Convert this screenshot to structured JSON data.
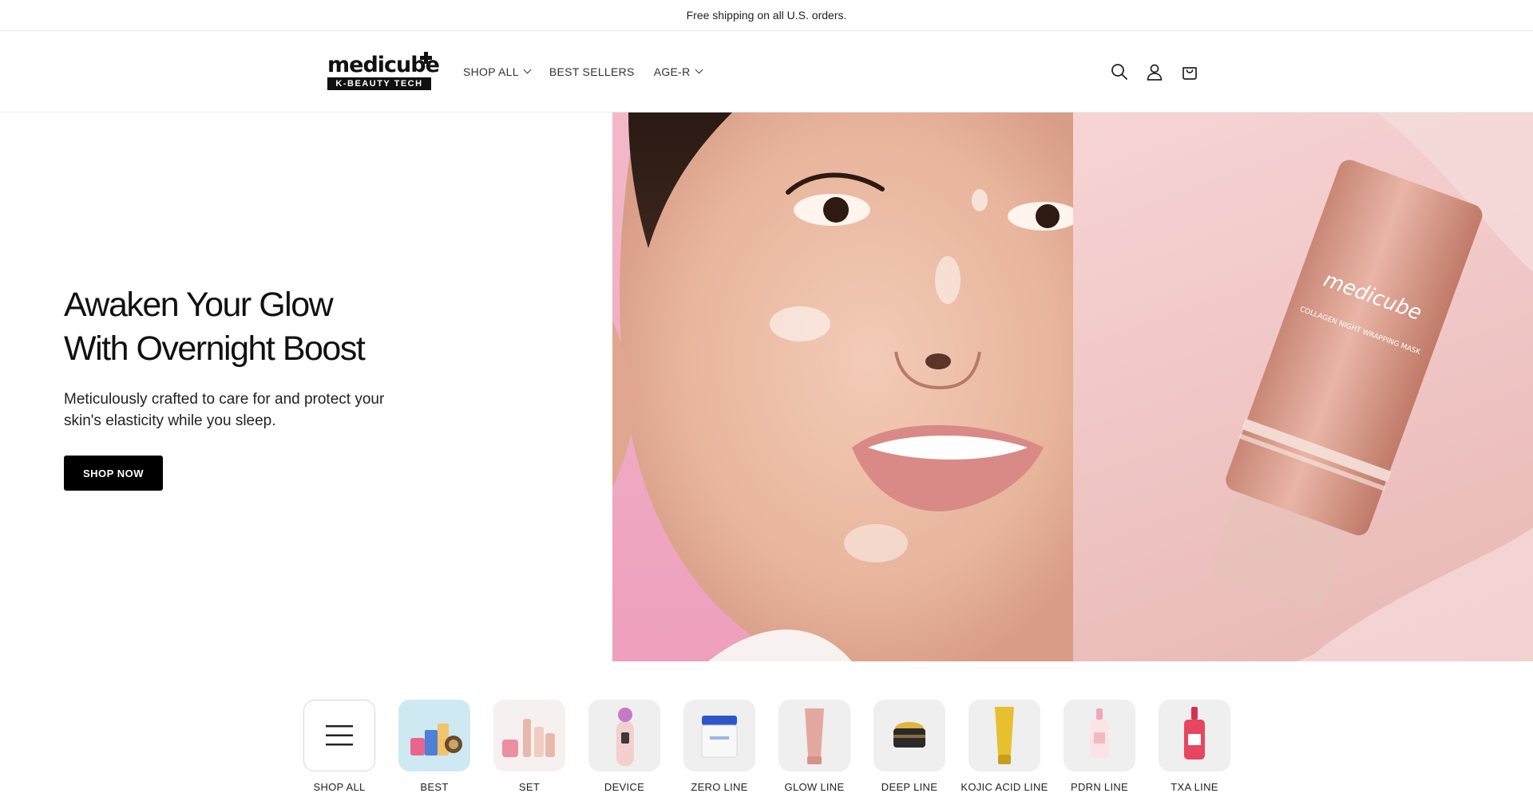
{
  "announcement": "Free shipping on all U.S. orders.",
  "brand": {
    "name": "medicube",
    "tagline": "K-BEAUTY TECH"
  },
  "nav": [
    {
      "label": "SHOP ALL",
      "has_dropdown": true
    },
    {
      "label": "BEST SELLERS",
      "has_dropdown": false
    },
    {
      "label": "AGE-R",
      "has_dropdown": true
    }
  ],
  "header_icons": [
    "search-icon",
    "account-icon",
    "cart-icon"
  ],
  "hero": {
    "title_line1": "Awaken Your Glow",
    "title_line2": "With Overnight Boost",
    "subtitle": "Meticulously crafted to care for and protect your skin's elasticity while you sleep.",
    "cta": "SHOP NOW",
    "product_brand": "medicube",
    "product_name": "COLLAGEN NIGHT WRAPPING MASK"
  },
  "categories": [
    {
      "label": "SHOP ALL",
      "icon": "menu-icon"
    },
    {
      "label": "BEST"
    },
    {
      "label": "SET"
    },
    {
      "label": "DEVICE"
    },
    {
      "label": "ZERO LINE"
    },
    {
      "label": "GLOW LINE"
    },
    {
      "label": "DEEP LINE"
    },
    {
      "label": "KOJIC ACID LINE"
    },
    {
      "label": "PDRN LINE"
    },
    {
      "label": "TXA LINE"
    }
  ],
  "colors": {
    "accent": "#000000",
    "hero_pink": "#f0b8c8",
    "product_pink": "#e9b1a8"
  }
}
